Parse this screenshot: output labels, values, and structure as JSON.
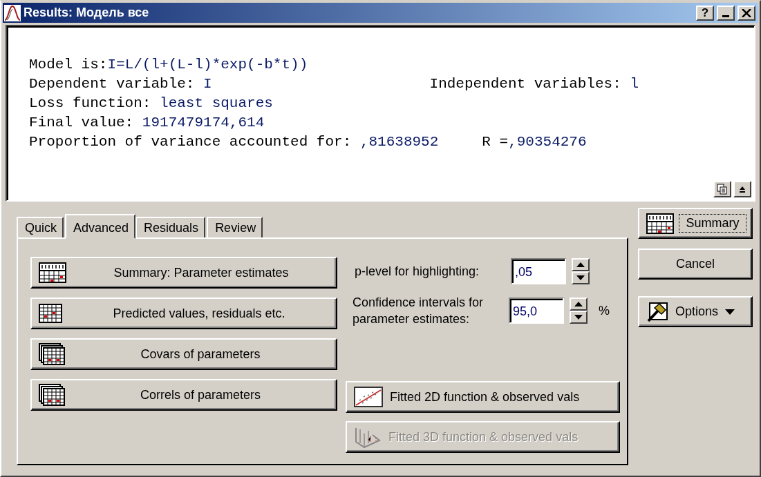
{
  "window": {
    "title": "Results: Модель все",
    "help_button": "?"
  },
  "output": {
    "lines": [
      {
        "segments": [
          {
            "label": "Model is:",
            "value": "I=L/(l+(L-l)*exp(-b*t))"
          }
        ]
      },
      {
        "segments": [
          {
            "label": "Dependent variable: ",
            "value": "I"
          },
          {
            "label": "Independent variables: ",
            "value": "l"
          }
        ]
      },
      {
        "segments": [
          {
            "label": "Loss function: ",
            "value": "least squares"
          }
        ]
      },
      {
        "segments": [
          {
            "label": "Final value: ",
            "value": "1917479174,614"
          }
        ]
      },
      {
        "segments": [
          {
            "label": "Proportion of variance accounted for: ",
            "value": ",81638952"
          },
          {
            "label": "R =",
            "value": ",90354276"
          }
        ]
      }
    ]
  },
  "tabs": [
    {
      "label": "Quick",
      "selected": false
    },
    {
      "label": "Advanced",
      "selected": true
    },
    {
      "label": "Residuals",
      "selected": false
    },
    {
      "label": "Review",
      "selected": false
    }
  ],
  "result_buttons": [
    {
      "label": "Summary: Parameter estimates"
    },
    {
      "label": "Predicted values, residuals etc."
    },
    {
      "label": "Covars of parameters"
    },
    {
      "label": "Correls of parameters"
    }
  ],
  "settings": [
    {
      "label": "p-level for highlighting:",
      "value": ",05"
    },
    {
      "label": "Confidence intervals for parameter estimates:",
      "value": "95,0",
      "unit": "%"
    }
  ],
  "graph_buttons": [
    {
      "label": "Fitted 2D function & observed vals",
      "disabled": false
    },
    {
      "label": "Fitted 3D function & observed vals",
      "disabled": true
    }
  ],
  "side_buttons": [
    {
      "label": "Summary",
      "kind": "push",
      "focused": true
    },
    {
      "label": "Cancel",
      "kind": "push",
      "focused": false
    },
    {
      "label": "Options",
      "kind": "menu",
      "focused": false
    }
  ]
}
